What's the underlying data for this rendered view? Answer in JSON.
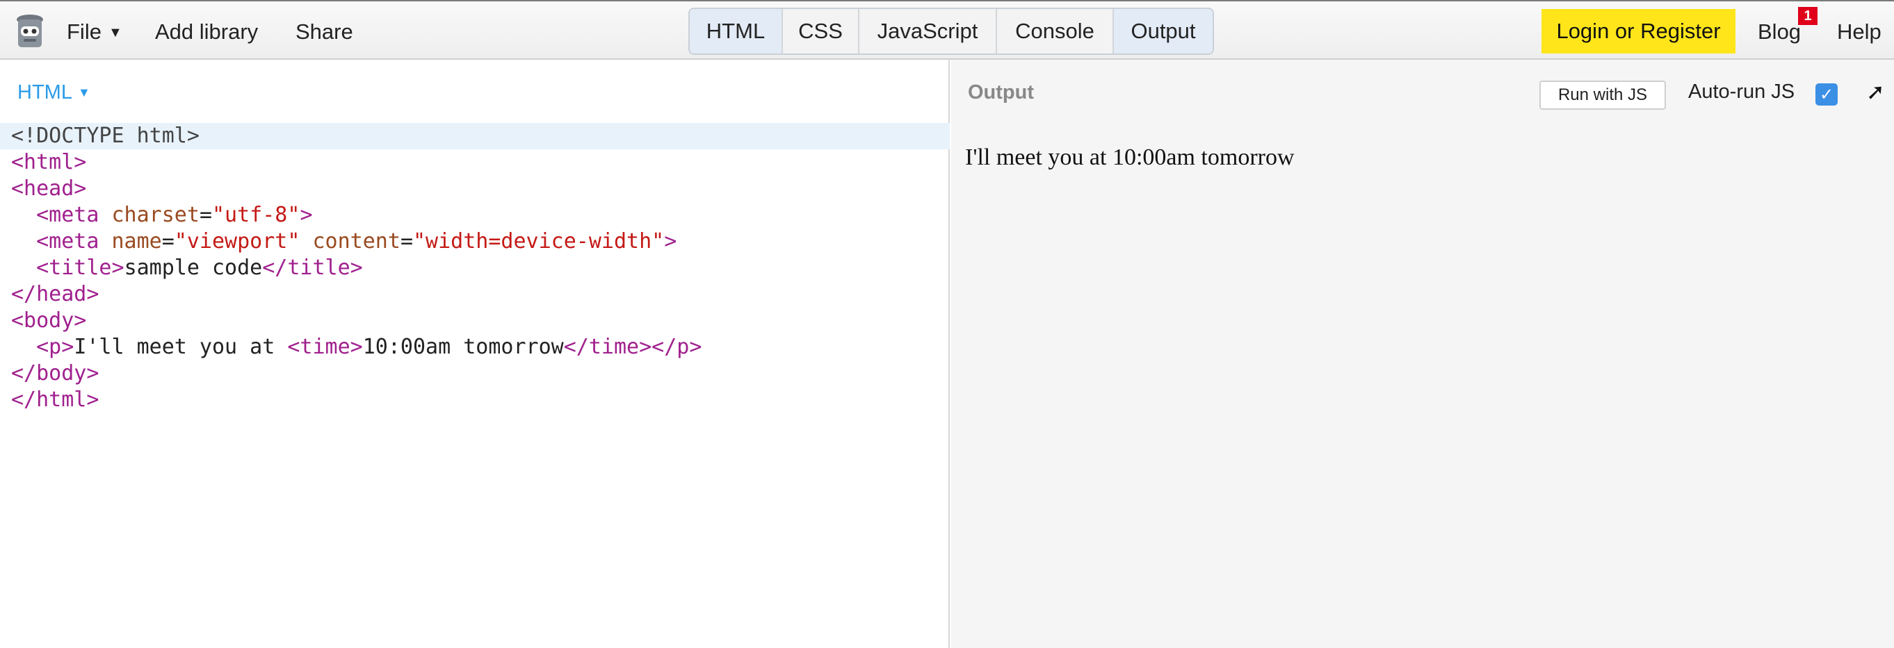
{
  "topbar": {
    "menu": {
      "file": "File",
      "add_library": "Add library",
      "share": "Share"
    },
    "tabs": [
      "HTML",
      "CSS",
      "JavaScript",
      "Console",
      "Output"
    ],
    "login": "Login or Register",
    "blog": "Blog",
    "blog_badge": "1",
    "help": "Help"
  },
  "editor": {
    "language": "HTML",
    "lines": [
      [
        {
          "t": "dt",
          "v": "<!DOCTYPE html>"
        }
      ],
      [
        {
          "t": "tg",
          "v": "<html>"
        }
      ],
      [
        {
          "t": "tg",
          "v": "<head>"
        }
      ],
      [
        {
          "t": "p",
          "v": "  "
        },
        {
          "t": "tg",
          "v": "<meta "
        },
        {
          "t": "at",
          "v": "charset"
        },
        {
          "t": "p",
          "v": "="
        },
        {
          "t": "sv",
          "v": "\"utf-8\""
        },
        {
          "t": "tg",
          "v": ">"
        }
      ],
      [
        {
          "t": "p",
          "v": "  "
        },
        {
          "t": "tg",
          "v": "<meta "
        },
        {
          "t": "at",
          "v": "name"
        },
        {
          "t": "p",
          "v": "="
        },
        {
          "t": "sv",
          "v": "\"viewport\""
        },
        {
          "t": "p",
          "v": " "
        },
        {
          "t": "at",
          "v": "content"
        },
        {
          "t": "p",
          "v": "="
        },
        {
          "t": "sv",
          "v": "\"width=device-width\""
        },
        {
          "t": "tg",
          "v": ">"
        }
      ],
      [
        {
          "t": "p",
          "v": "  "
        },
        {
          "t": "tg",
          "v": "<title>"
        },
        {
          "t": "p",
          "v": "sample code"
        },
        {
          "t": "tg",
          "v": "</title>"
        }
      ],
      [
        {
          "t": "tg",
          "v": "</head>"
        }
      ],
      [
        {
          "t": "tg",
          "v": "<body>"
        }
      ],
      [
        {
          "t": "p",
          "v": "  "
        },
        {
          "t": "tg",
          "v": "<p>"
        },
        {
          "t": "p",
          "v": "I'll meet you at "
        },
        {
          "t": "tg",
          "v": "<time>"
        },
        {
          "t": "p",
          "v": "10:00am tomorrow"
        },
        {
          "t": "tg",
          "v": "</time></p>"
        }
      ],
      [
        {
          "t": "tg",
          "v": "</body>"
        }
      ],
      [
        {
          "t": "tg",
          "v": "</html>"
        }
      ]
    ]
  },
  "output": {
    "title": "Output",
    "run_button": "Run with JS",
    "autorun_label": "Auto-run JS",
    "autorun_checked": true,
    "result_text": "I'll meet you at 10:00am tomorrow"
  },
  "colors": {
    "accent": "#2a9be8",
    "login_bg": "#ffe51a",
    "badge": "#e0001b",
    "tag": "#a0208e",
    "attr": "#9a4a21",
    "string": "#c41a16"
  }
}
